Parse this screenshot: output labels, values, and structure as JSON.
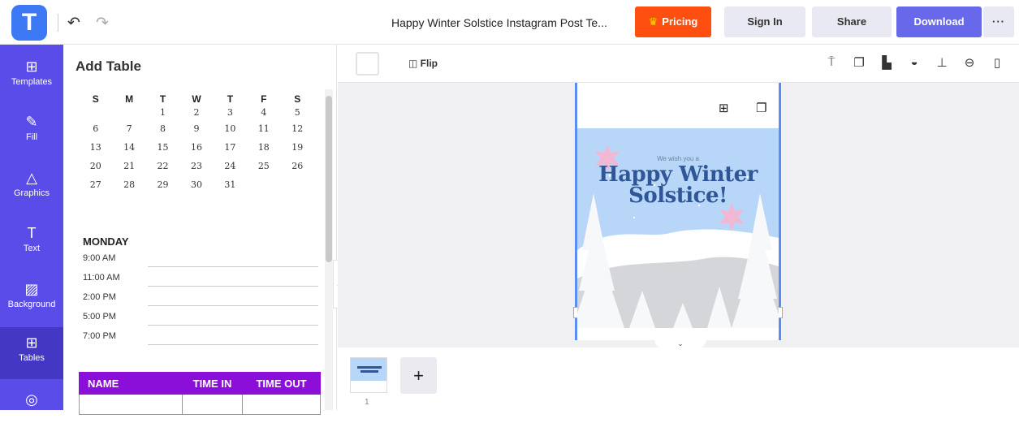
{
  "app": {
    "logo_letter": "T"
  },
  "header": {
    "document_title": "Happy Winter Solstice Instagram Post Te...",
    "pricing_label": "Pricing",
    "signin_label": "Sign In",
    "share_label": "Share",
    "download_label": "Download",
    "more_label": "···",
    "undo_icon": "undo-icon",
    "redo_icon": "redo-icon"
  },
  "colors": {
    "nav_bg": "#5a4ce9",
    "pricing": "#ff4f10",
    "download": "#6868ea",
    "table_header": "#8b0fd8",
    "selection": "#5b8df2"
  },
  "sidebar": {
    "items": [
      {
        "label": "Templates",
        "icon": "templates-icon",
        "glyph": "⊞"
      },
      {
        "label": "Fill",
        "icon": "pencil-icon",
        "glyph": "✎"
      },
      {
        "label": "Graphics",
        "icon": "shapes-icon",
        "glyph": "△"
      },
      {
        "label": "Text",
        "icon": "text-icon",
        "glyph": "T"
      },
      {
        "label": "Background",
        "icon": "background-icon",
        "glyph": "▨"
      },
      {
        "label": "Tables",
        "icon": "table-icon",
        "glyph": "⊞",
        "active": true
      },
      {
        "label": "",
        "icon": "more-icon",
        "glyph": "◎"
      }
    ]
  },
  "panel": {
    "title": "Add Table",
    "calendar": {
      "weekdays": [
        "S",
        "M",
        "T",
        "W",
        "T",
        "F",
        "S"
      ],
      "weeks": [
        [
          "",
          "",
          "1",
          "2",
          "3",
          "4",
          "5"
        ],
        [
          "6",
          "7",
          "8",
          "9",
          "10",
          "11",
          "12"
        ],
        [
          "13",
          "14",
          "15",
          "16",
          "17",
          "18",
          "19"
        ],
        [
          "20",
          "21",
          "22",
          "23",
          "24",
          "25",
          "26"
        ],
        [
          "27",
          "28",
          "29",
          "30",
          "31",
          "",
          ""
        ]
      ]
    },
    "schedule": {
      "day": "MONDAY",
      "times": [
        "9:00 AM",
        "11:00 AM",
        "2:00 PM",
        "5:00 PM",
        "7:00 PM"
      ]
    },
    "timesheet": {
      "headers": [
        "NAME",
        "TIME IN",
        "TIME OUT"
      ]
    }
  },
  "toolbar": {
    "flip_label": "Flip",
    "tools": [
      "paint-roller-icon",
      "copy-icon",
      "layer-icon",
      "opacity-icon",
      "align-icon",
      "link-icon",
      "trash-icon"
    ]
  },
  "artboard": {
    "subtitle": "We wish you a",
    "title_line1": "Happy Winter",
    "title_line2": "Solstice!"
  },
  "pages": {
    "current_page_number": "1",
    "add_label": "+"
  }
}
